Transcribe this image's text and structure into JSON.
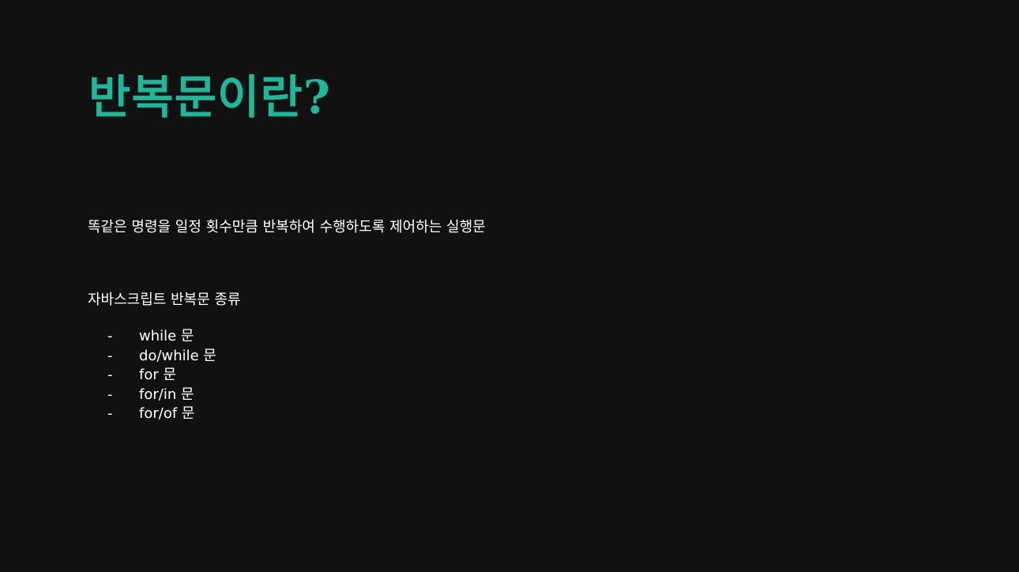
{
  "slide": {
    "title": "반복문이란?",
    "definition": "똑같은 명령을 일정 횟수만큼 반복하여 수행하도록 제어하는 실행문",
    "types_heading": "자바스크립트 반복문 종류",
    "bullet_symbol": "-",
    "types": [
      "while 문",
      "do/while 문",
      "for 문",
      "for/in 문",
      "for/of 문"
    ]
  },
  "colors": {
    "background": "#111111",
    "title": "#1db79a",
    "text": "#ffffff"
  }
}
